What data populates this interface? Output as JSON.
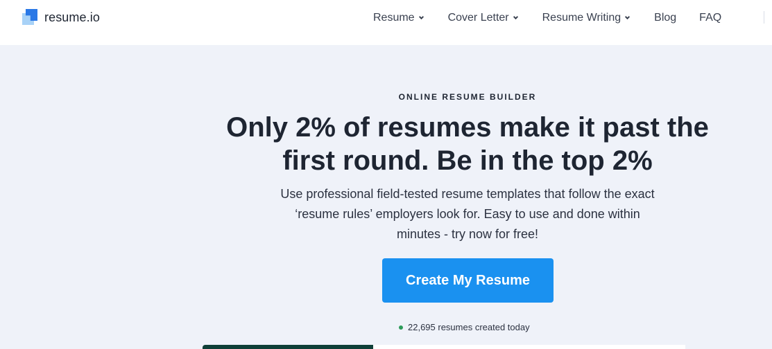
{
  "header": {
    "logo_text": "resume.io",
    "nav": [
      {
        "label": "Resume",
        "has_dropdown": true
      },
      {
        "label": "Cover Letter",
        "has_dropdown": true
      },
      {
        "label": "Resume Writing",
        "has_dropdown": true
      },
      {
        "label": "Blog",
        "has_dropdown": false
      },
      {
        "label": "FAQ",
        "has_dropdown": false
      }
    ]
  },
  "hero": {
    "eyebrow": "ONLINE RESUME BUILDER",
    "headline_line1": "Only 2% of resumes make it past the",
    "headline_line2": "first round. Be in the top 2%",
    "subtext_line1": "Use professional field-tested resume templates that follow the exact",
    "subtext_line2": "‘resume rules’ employers look for. Easy to use and done within",
    "subtext_line3": "minutes - try now for free!",
    "cta_label": "Create My Resume",
    "counter_text": "22,695 resumes created today"
  },
  "colors": {
    "brand_blue": "#1a91f0",
    "background": "#eff2f9",
    "status_green": "#2d9b5a"
  }
}
